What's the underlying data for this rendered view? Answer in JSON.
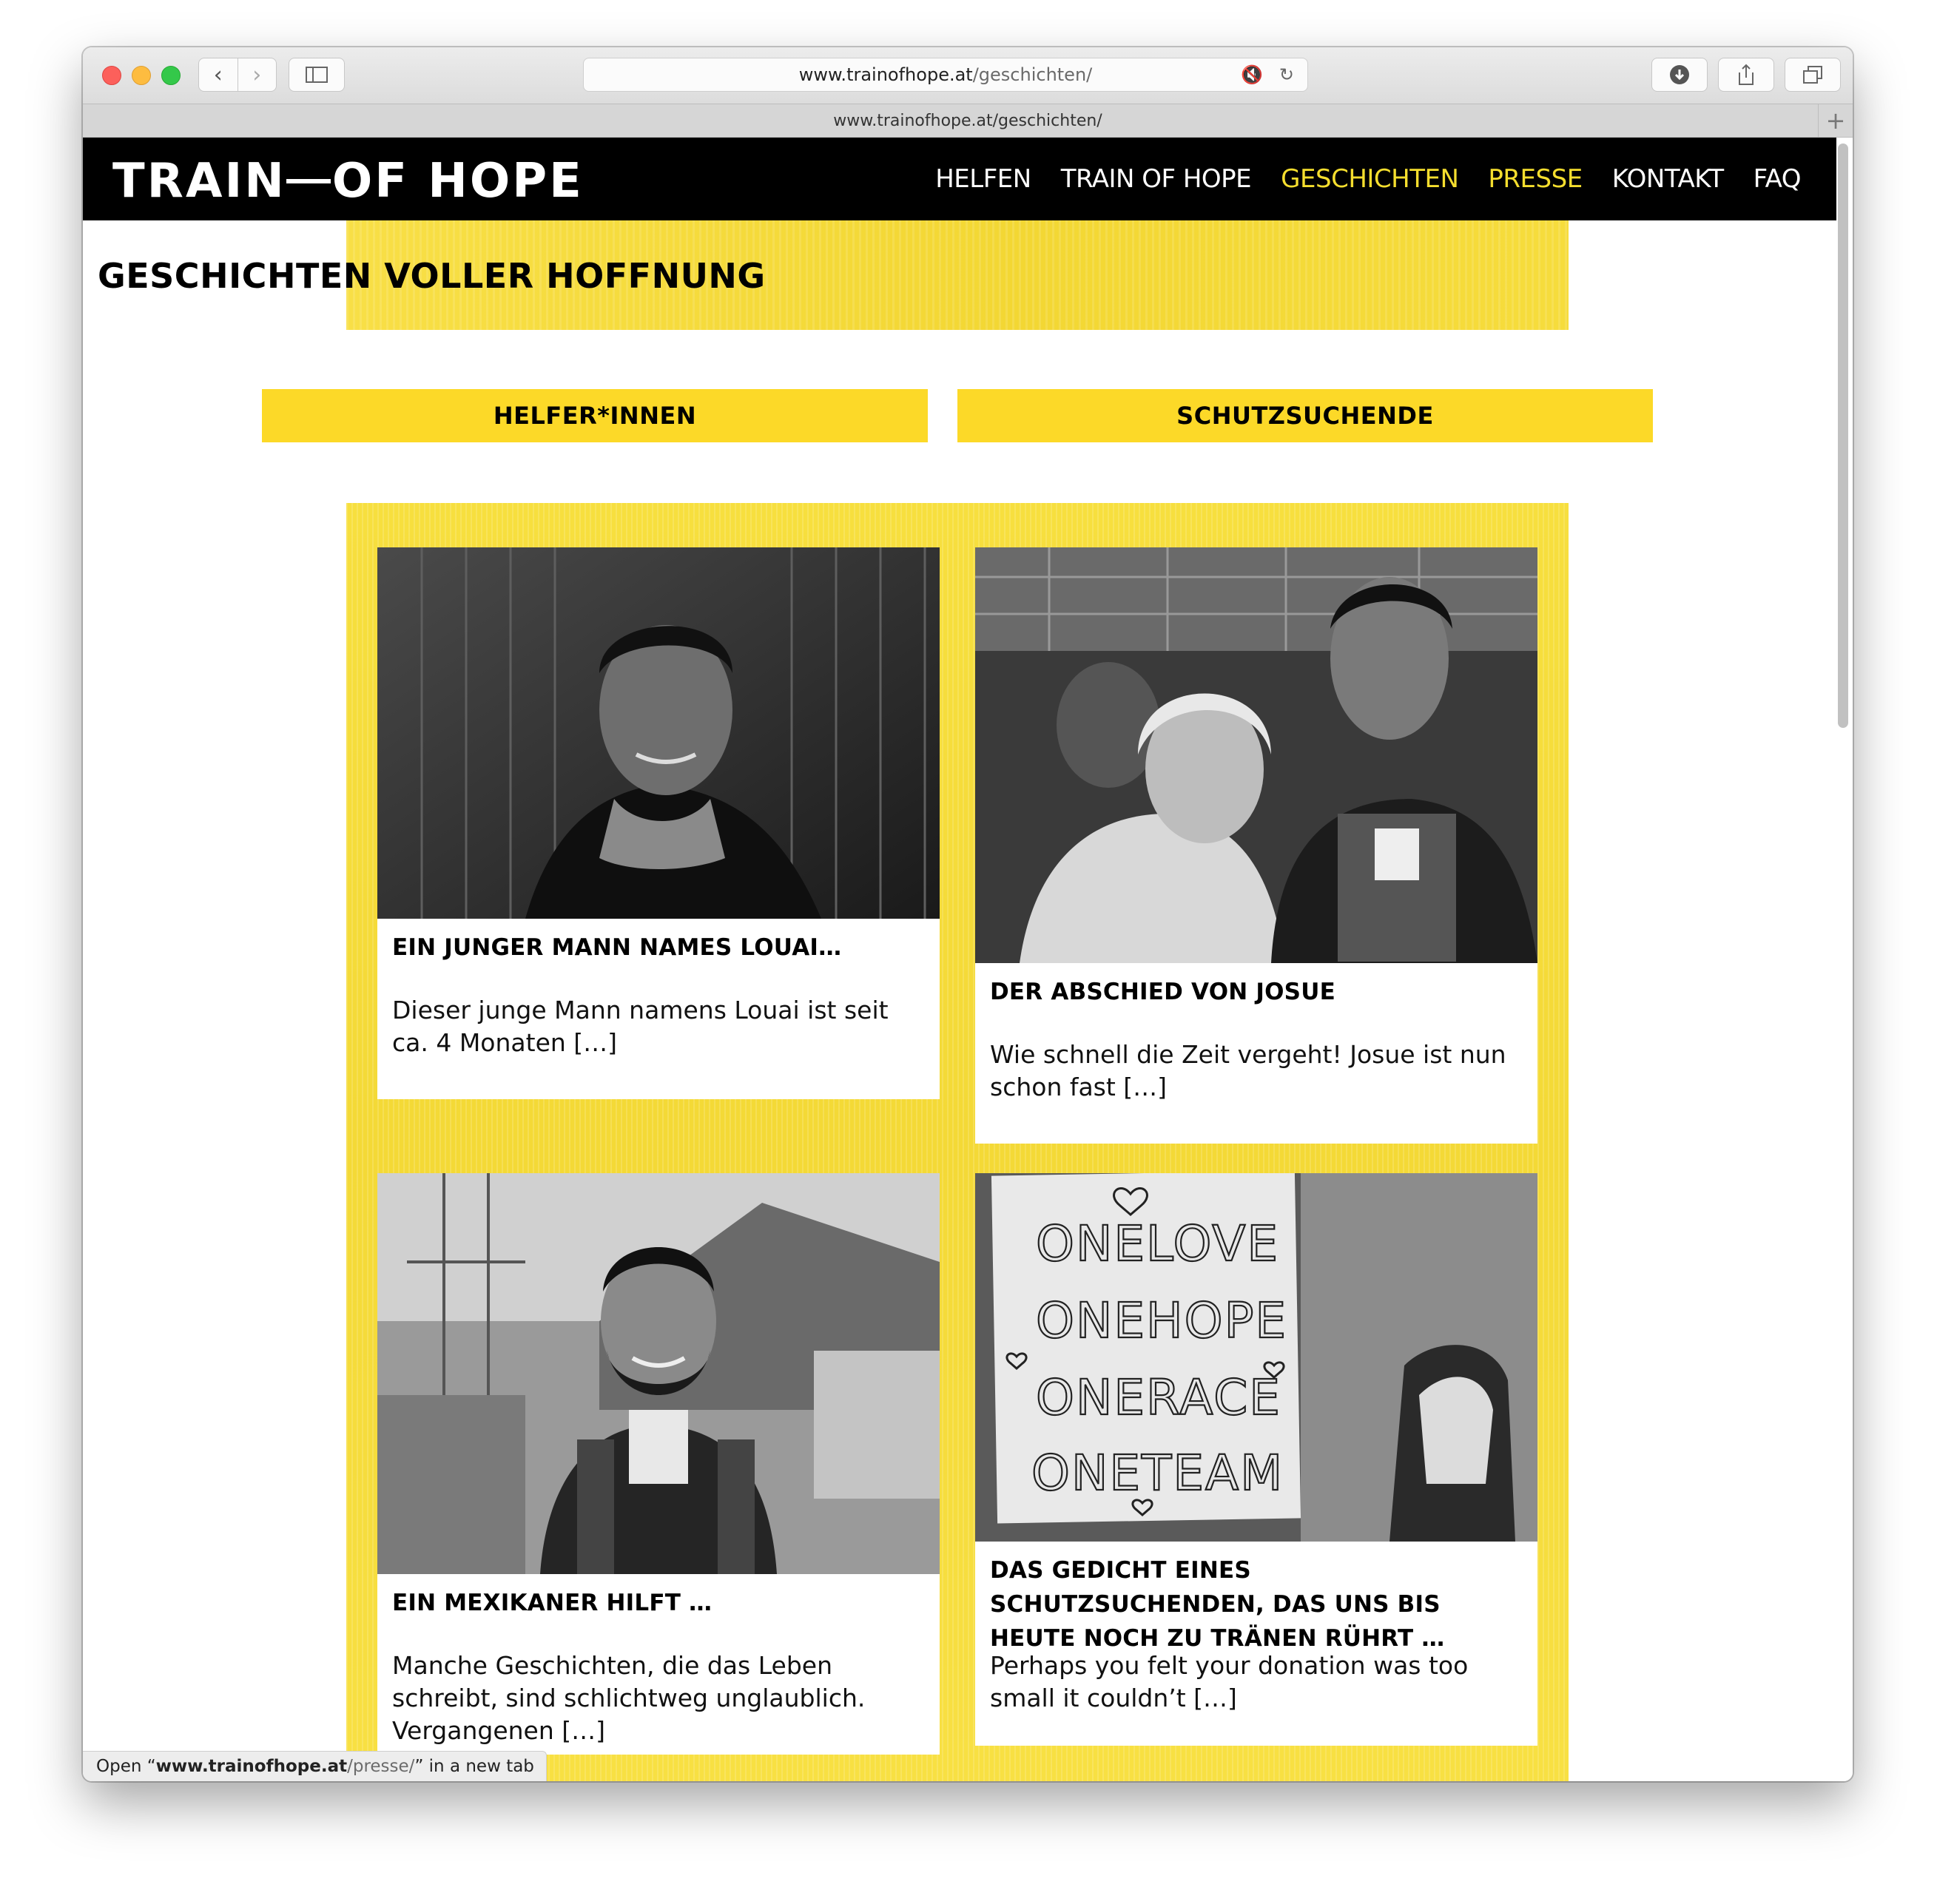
{
  "browser": {
    "address_domain": "www.trainofhope.at",
    "address_path": "/geschichten/",
    "tab_title": "www.trainofhope.at/geschichten/",
    "status_prefix": "Open “",
    "status_domain": "www.trainofhope.at",
    "status_path": "/presse/",
    "status_suffix": "” in a new tab"
  },
  "site": {
    "logo_left": "TRAIN",
    "logo_right": "OF HOPE",
    "nav": [
      {
        "label": "HELFEN",
        "active": false
      },
      {
        "label": "TRAIN OF HOPE",
        "active": false
      },
      {
        "label": "GESCHICHTEN",
        "active": true
      },
      {
        "label": "PRESSE",
        "active": true
      },
      {
        "label": "KONTAKT",
        "active": false
      },
      {
        "label": "FAQ",
        "active": false
      }
    ],
    "accent_color": "#fcd928"
  },
  "page": {
    "title": "GESCHICHTEN VOLLER HOFFNUNG",
    "filters": [
      "HELFER*INNEN",
      "SCHUTZSUCHENDE"
    ]
  },
  "stories": [
    {
      "title": "EIN JUNGER MANN NAMES LOUAI…",
      "excerpt": "Dieser junge Mann namens Louai ist seit ca. 4 Monaten […]",
      "photo": "portrait-young-man"
    },
    {
      "title": "DER ABSCHIED VON JOSUE",
      "excerpt": "Wie schnell die Zeit vergeht! Josue ist nun schon fast […]",
      "photo": "group-farewell-photo"
    },
    {
      "title": "EIN MEXIKANER HILFT …",
      "excerpt": "Manche Geschichten, die das Leben schreibt, sind schlichtweg unglaublich. Vergangenen […]",
      "photo": "man-with-backpack-photo"
    },
    {
      "title": "DAS GEDICHT EINES SCHUTZSUCHENDEN, DAS UNS BIS HEUTE NOCH ZU TRÄNEN RÜHRT …",
      "excerpt": "Perhaps you felt your donation was too small it couldn’t […]",
      "photo": "handwritten-sign-photo",
      "sign_lines": [
        "ONELOVE",
        "ONEHOPE",
        "ONERACE",
        "ONETEAM"
      ]
    }
  ]
}
